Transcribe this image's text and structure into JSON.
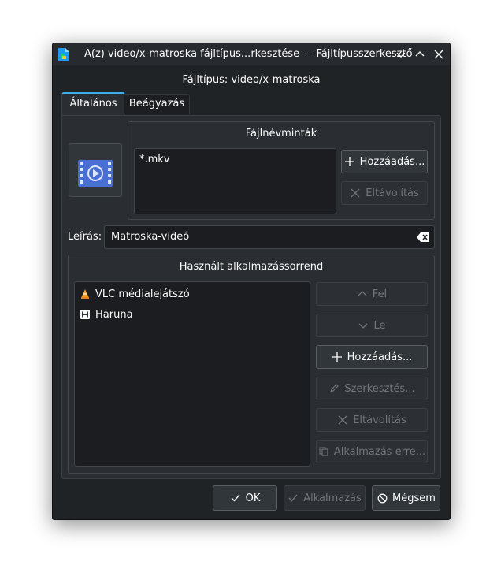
{
  "window": {
    "title": "A(z) video/x-matroska fájltípus...rkesztése — Fájltípusszerkesztő"
  },
  "header": {
    "subtitle": "Fájltípus: video/x-matroska"
  },
  "tabs": [
    {
      "label": "Általános",
      "active": true
    },
    {
      "label": "Beágyazás",
      "active": false
    }
  ],
  "filename_patterns": {
    "title": "Fájlnévminták",
    "items": [
      "*.mkv"
    ],
    "add_label": "Hozzáadás...",
    "remove_label": "Eltávolítás"
  },
  "description": {
    "label": "Leírás:",
    "value": "Matroska-videó"
  },
  "app_order": {
    "title": "Használt alkalmazássorrend",
    "apps": [
      {
        "name": "VLC médialejátszó",
        "icon": "vlc-icon"
      },
      {
        "name": "Haruna",
        "icon": "haruna-icon"
      }
    ],
    "up_label": "Fel",
    "down_label": "Le",
    "add_label": "Hozzáadás...",
    "edit_label": "Szerkesztés...",
    "remove_label": "Eltávolítás",
    "apply_to_label": "Alkalmazás erre..."
  },
  "footer": {
    "ok_label": "OK",
    "apply_label": "Alkalmazás",
    "cancel_label": "Mégsem"
  },
  "colors": {
    "window_bg": "#202326",
    "panel_bg": "#2a2e32",
    "accent": "#3daee9",
    "text": "#fcfcfc",
    "disabled_text": "#727579"
  }
}
